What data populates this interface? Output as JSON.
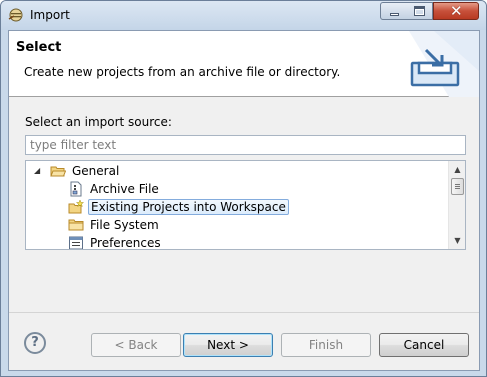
{
  "window": {
    "title": "Import"
  },
  "header": {
    "title": "Select",
    "description": "Create new projects from an archive file or directory."
  },
  "source": {
    "label": "Select an import source:",
    "filter_placeholder": "type filter text"
  },
  "tree": {
    "items": [
      {
        "label": "General",
        "icon": "folder-open-icon",
        "expanded": true
      },
      {
        "label": "Archive File",
        "icon": "archive-file-icon"
      },
      {
        "label": "Existing Projects into Workspace",
        "icon": "new-project-icon",
        "selected": true
      },
      {
        "label": "File System",
        "icon": "folder-icon"
      },
      {
        "label": "Preferences",
        "icon": "preferences-icon"
      }
    ]
  },
  "buttons": {
    "help": "?",
    "back": "< Back",
    "next": "Next >",
    "finish": "Finish",
    "cancel": "Cancel"
  },
  "colors": {
    "selection_border": "#84acdd",
    "close_button": "#c7503a",
    "folder": "#e8b84a"
  }
}
